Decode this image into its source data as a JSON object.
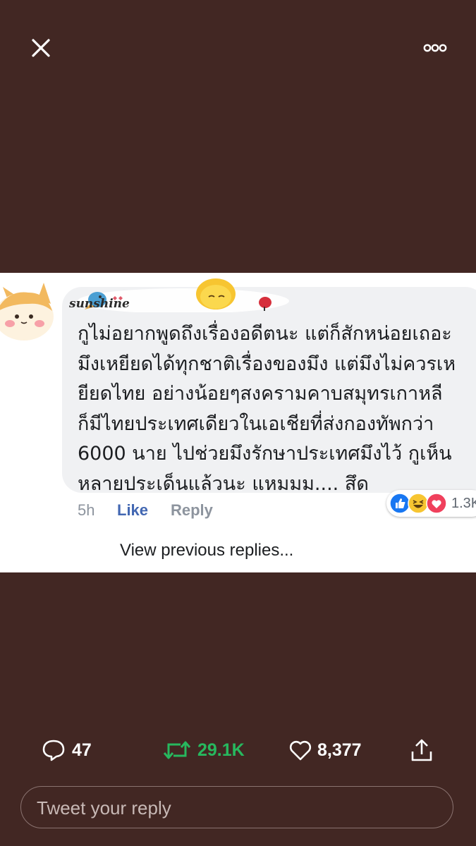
{
  "colors": {
    "background": "#422723",
    "retweet_green": "#27b85e",
    "like_blue": "#4267b2"
  },
  "top_bar": {
    "close_icon": "x-icon",
    "more_icon": "ellipsis-icon"
  },
  "comment": {
    "author": "sunshine",
    "lines": [
      "กูไม่อยากพูดถึงเรื่องอดีตนะ แต่ก็สักหน่อยเถอะ",
      "มึงเหยียดได้ทุกชาติเรื่องของมึง แต่มึงไม่ควรเห",
      "ยียดไทย อย่างน้อยๆสงครามคาบสมุทรเกาหลี",
      "ก็มีไทยประเทศเดียวในเอเชียที่ส่งกองทัพกว่า",
      "6000 นาย ไปช่วยมึงรักษาประเทศมึงไว้ กูเห็น",
      "หลายประเด็นแล้วนะ แหมมม.... สึด"
    ],
    "time": "5h",
    "like_label": "Like",
    "reply_label": "Reply",
    "reaction_count": "1.3K",
    "reaction_icons": [
      "like-reaction-icon",
      "haha-reaction-icon",
      "love-reaction-icon"
    ],
    "view_previous": "View previous replies..."
  },
  "tweet_stats": {
    "replies": "47",
    "retweets": "29.1K",
    "likes": "8,377"
  },
  "reply_box": {
    "placeholder": "Tweet your reply"
  }
}
